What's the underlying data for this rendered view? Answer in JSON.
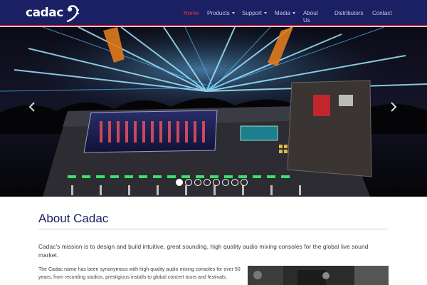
{
  "brand": {
    "name": "cadac"
  },
  "nav": {
    "items": [
      {
        "label": "Home",
        "active": true,
        "dropdown": false
      },
      {
        "label": "Products",
        "active": false,
        "dropdown": true
      },
      {
        "label": "Support",
        "active": false,
        "dropdown": true
      },
      {
        "label": "Media",
        "active": false,
        "dropdown": true
      },
      {
        "label": "About Us",
        "active": false,
        "dropdown": false
      },
      {
        "label": "Distributors",
        "active": false,
        "dropdown": false
      },
      {
        "label": "Contact",
        "active": false,
        "dropdown": false
      }
    ]
  },
  "hero": {
    "prev_icon": "chevron-left-icon",
    "next_icon": "chevron-right-icon",
    "slide_count": 8,
    "active_slide": 1
  },
  "about": {
    "title": "About Cadac",
    "mission": "Cadac's mission is to design and build intuitive, great sounding, high quality audio mixing consoles for the global live sound market.",
    "history": "The Cadac name has been synonymous with high quality audio mixing consoles for over 50 years, from recording studios, prestigious installs to global concert tours and festivals."
  },
  "colors": {
    "navbar": "#1b1f63",
    "accent": "#c0272d",
    "active_nav": "#e03a3a",
    "title": "#1b1f63"
  }
}
